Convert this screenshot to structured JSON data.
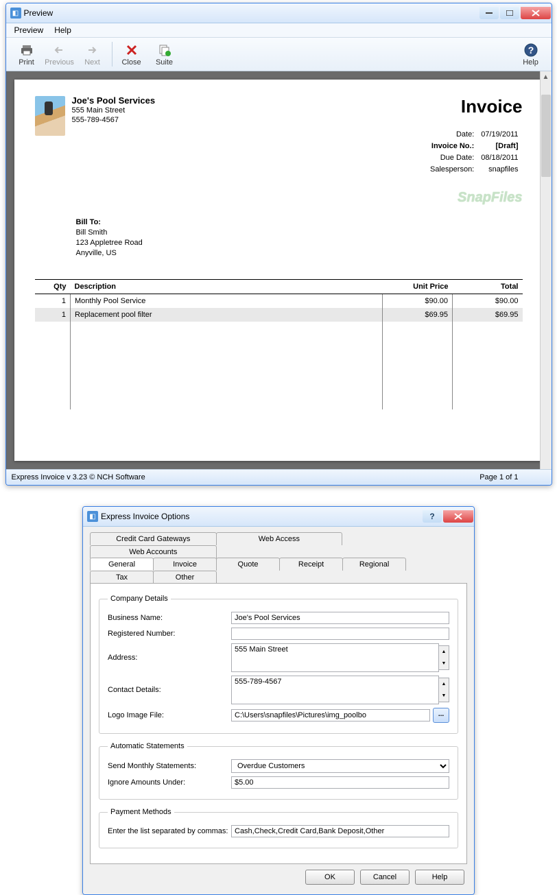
{
  "preview": {
    "title": "Preview",
    "menu": {
      "preview": "Preview",
      "help": "Help"
    },
    "toolbar": {
      "print": "Print",
      "previous": "Previous",
      "next": "Next",
      "close": "Close",
      "suite": "Suite",
      "help": "Help"
    },
    "status_left": "Express Invoice v 3.23 © NCH Software",
    "status_right": "Page 1 of 1"
  },
  "invoice": {
    "company": {
      "name": "Joe's Pool Services",
      "addr1": "555 Main Street",
      "addr2": "555-789-4567"
    },
    "title": "Invoice",
    "meta": {
      "date_label": "Date:",
      "date": "07/19/2011",
      "invno_label": "Invoice No.:",
      "invno": "[Draft]",
      "due_label": "Due Date:",
      "due": "08/18/2011",
      "sales_label": "Salesperson:",
      "sales": "snapfiles"
    },
    "bill": {
      "label": "Bill To:",
      "name": "Bill Smith",
      "addr": "123 Appletree Road",
      "city": "Anyville, US"
    },
    "watermark": "SnapFiles",
    "cols": {
      "qty": "Qty",
      "desc": "Description",
      "unit": "Unit Price",
      "total": "Total"
    },
    "rows": [
      {
        "qty": "1",
        "desc": "Monthly Pool Service",
        "unit": "$90.00",
        "total": "$90.00"
      },
      {
        "qty": "1",
        "desc": "Replacement pool filter",
        "unit": "$69.95",
        "total": "$69.95"
      }
    ]
  },
  "options": {
    "title": "Express Invoice Options",
    "tabs_top": [
      "Credit Card Gateways",
      "Web Access",
      "Web Accounts"
    ],
    "tabs_bottom": [
      "General",
      "Invoice",
      "Quote",
      "Receipt",
      "Regional",
      "Tax",
      "Other"
    ],
    "company_legend": "Company Details",
    "fields": {
      "bizname": "Business Name:",
      "bizname_v": "Joe's Pool Services",
      "regnum": "Registered Number:",
      "regnum_v": "",
      "address": "Address:",
      "address_v": "555 Main Street",
      "contact": "Contact Details:",
      "contact_v": "555-789-4567",
      "logo": "Logo Image File:",
      "logo_v": "C:\\Users\\snapfiles\\Pictures\\img_poolbo"
    },
    "auto_legend": "Automatic Statements",
    "auto": {
      "sendm": "Send Monthly Statements:",
      "sendm_v": "Overdue Customers",
      "ignore": "Ignore Amounts Under:",
      "ignore_v": "$5.00"
    },
    "pay_legend": "Payment Methods",
    "pay": {
      "label": "Enter the list separated by commas:",
      "value": "Cash,Check,Credit Card,Bank Deposit,Other"
    },
    "buttons": {
      "ok": "OK",
      "cancel": "Cancel",
      "help": "Help"
    }
  }
}
